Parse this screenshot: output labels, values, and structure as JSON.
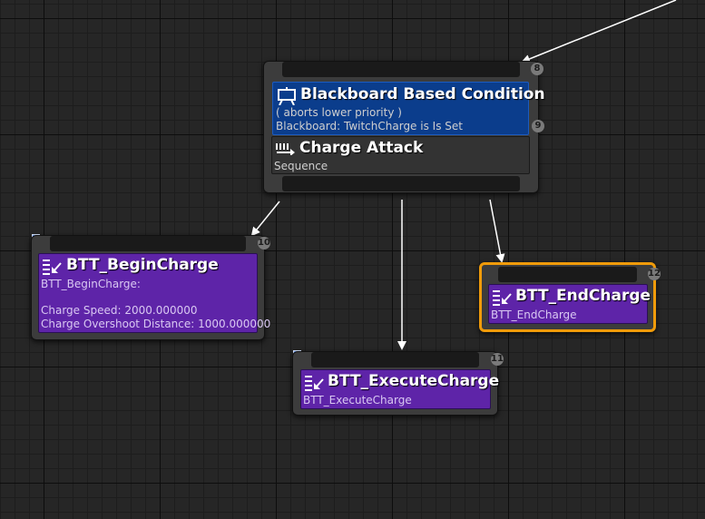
{
  "nodes": {
    "root": {
      "index": "8",
      "decorator": {
        "title": "Blackboard Based Condition",
        "line1": "( aborts lower priority )",
        "line2": "Blackboard: TwitchCharge is Is Set",
        "index": "9"
      },
      "composite": {
        "title": "Charge Attack",
        "type": "Sequence"
      }
    },
    "begin_charge": {
      "index": "10",
      "title": "BTT_BeginCharge",
      "line1": "BTT_BeginCharge:",
      "line2": "Charge Speed: 2000.000000",
      "line3": "Charge Overshoot Distance: 1000.000000"
    },
    "execute_charge": {
      "index": "11",
      "title": "BTT_ExecuteCharge",
      "line1": "BTT_ExecuteCharge"
    },
    "end_charge": {
      "index": "12",
      "title": "BTT_EndCharge",
      "line1": "BTT_EndCharge"
    }
  },
  "colors": {
    "decorator": "#0b3d8c",
    "task": "#5e24a8",
    "selection": "#f09b0a",
    "wire": "#ffffff"
  },
  "icons": {
    "decorator": "blackboard-condition-icon",
    "composite": "sequence-icon",
    "task": "task-icon"
  }
}
